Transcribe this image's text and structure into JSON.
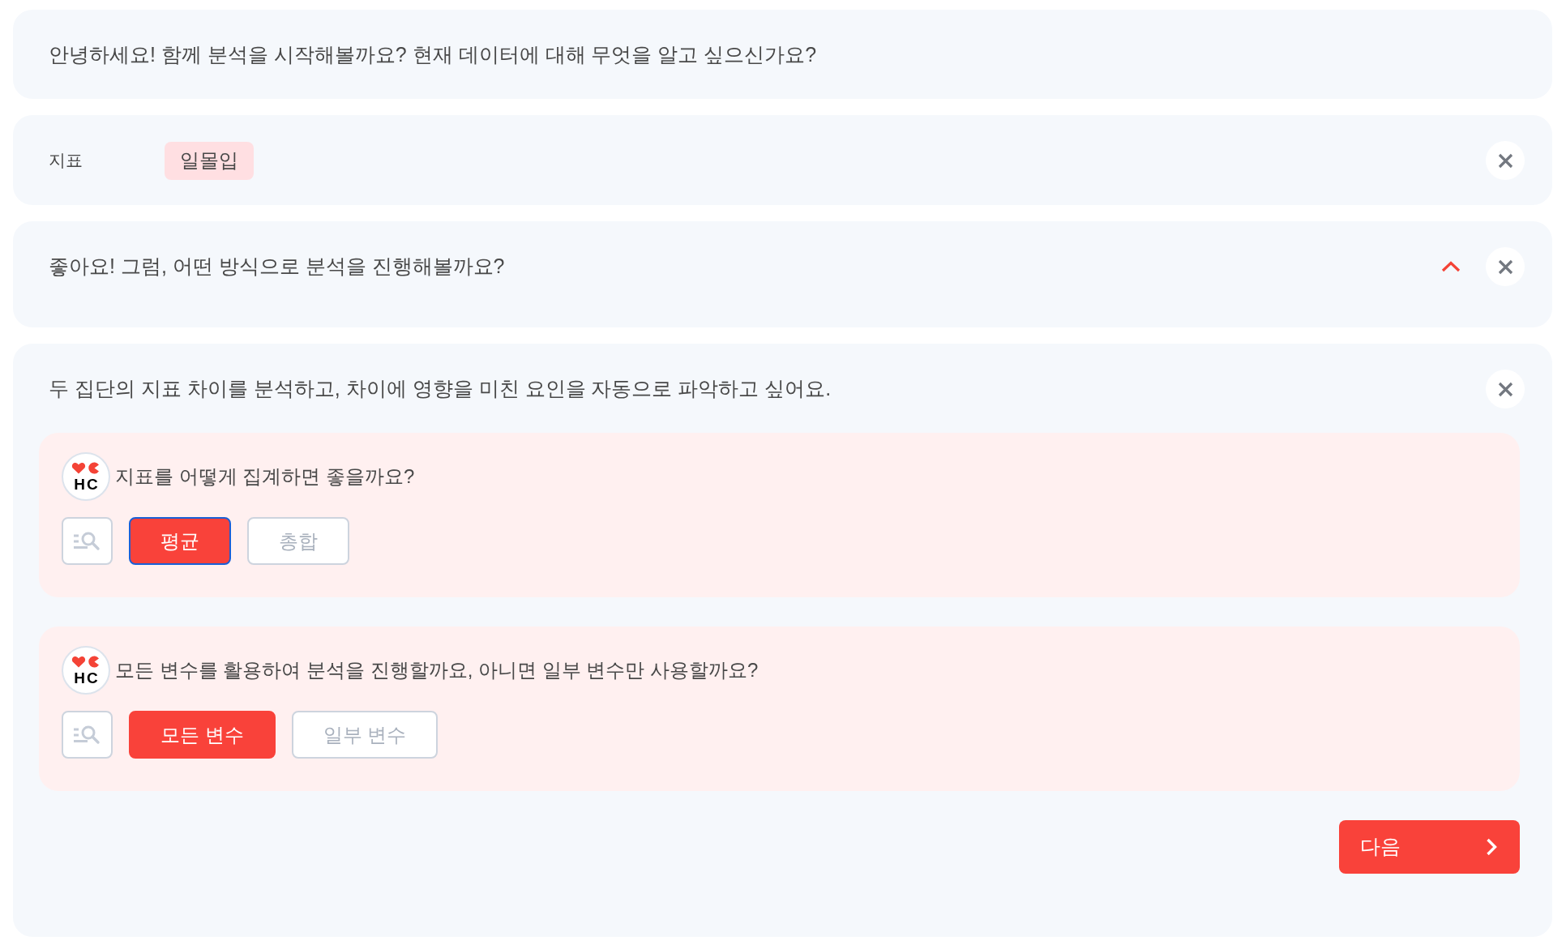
{
  "greeting": {
    "text": "안녕하세요! 함께 분석을 시작해볼까요? 현재 데이터에 대해 무엇을 알고 싶으신가요?"
  },
  "metric": {
    "label": "지표",
    "tag": "일몰입"
  },
  "method": {
    "text": "좋아요! 그럼, 어떤 방식으로 분석을 진행해볼까요?",
    "expanded": true
  },
  "answer": {
    "text": "두 집단의 지표 차이를 분석하고, 차이에 영향을 미친 요인을 자동으로 파악하고 싶어요.",
    "questions": [
      {
        "avatar": "HC",
        "text": "지표를 어떻게 집계하면 좋을까요?",
        "options": [
          {
            "label": "평균",
            "selected": true,
            "focused": true
          },
          {
            "label": "총합",
            "selected": false,
            "focused": false
          }
        ]
      },
      {
        "avatar": "HC",
        "text": "모든 변수를 활용하여 분석을 진행할까요, 아니면 일부 변수만 사용할까요?",
        "options": [
          {
            "label": "모든 변수",
            "selected": true,
            "focused": false
          },
          {
            "label": "일부 변수",
            "selected": false,
            "focused": false
          }
        ]
      }
    ],
    "next_button": {
      "label": "다음"
    }
  }
}
